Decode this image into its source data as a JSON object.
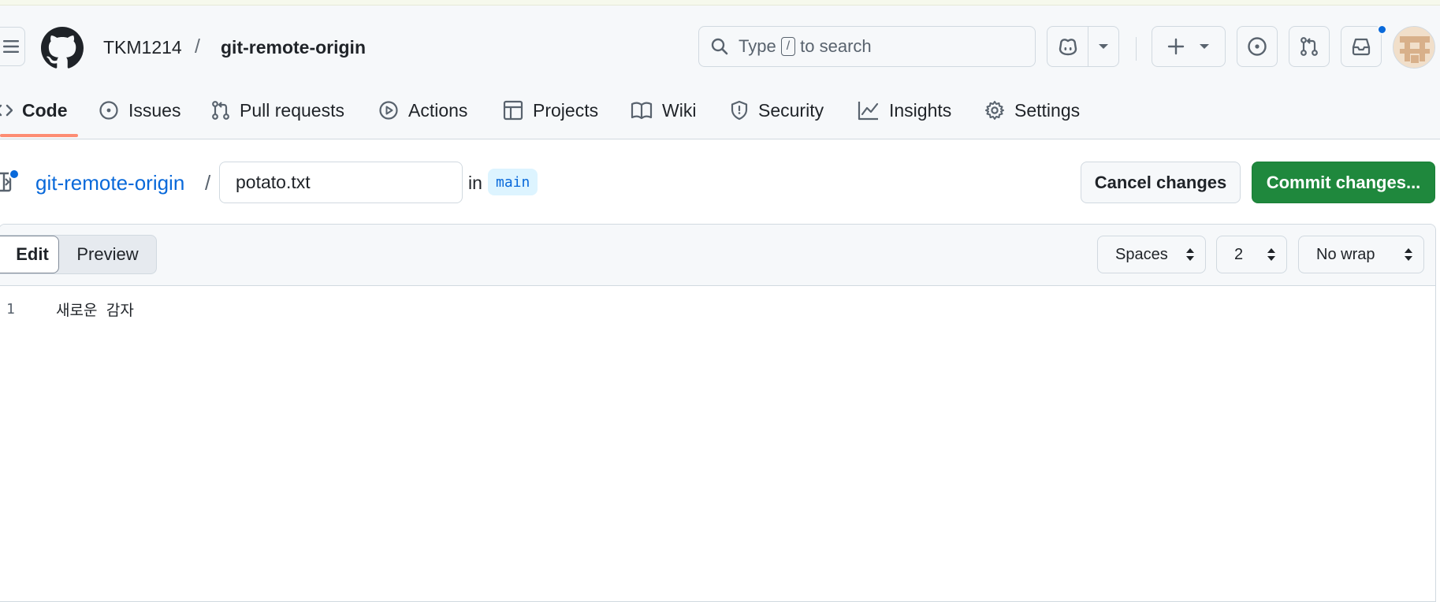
{
  "header": {
    "owner": "TKM1214",
    "separator": "/",
    "repo": "git-remote-origin",
    "search": {
      "prefix": "Type",
      "key": "/",
      "suffix": "to search"
    }
  },
  "tabs": [
    {
      "label": "Code",
      "icon": "code-icon"
    },
    {
      "label": "Issues",
      "icon": "issue-icon"
    },
    {
      "label": "Pull requests",
      "icon": "pull-request-icon"
    },
    {
      "label": "Actions",
      "icon": "play-icon"
    },
    {
      "label": "Projects",
      "icon": "table-icon"
    },
    {
      "label": "Wiki",
      "icon": "book-icon"
    },
    {
      "label": "Security",
      "icon": "shield-icon"
    },
    {
      "label": "Insights",
      "icon": "graph-icon"
    },
    {
      "label": "Settings",
      "icon": "gear-icon"
    }
  ],
  "file_bar": {
    "repo_link": "git-remote-origin",
    "separator": "/",
    "filename": "potato.txt",
    "in_label": "in",
    "branch": "main",
    "cancel_label": "Cancel changes",
    "commit_label": "Commit changes..."
  },
  "editor": {
    "edit_label": "Edit",
    "preview_label": "Preview",
    "indent_mode": "Spaces",
    "indent_size": "2",
    "wrap_mode": "No wrap",
    "lines": [
      {
        "number": "1",
        "text": "새로운 감자"
      }
    ]
  },
  "colors": {
    "accent_blue": "#0969da",
    "commit_green": "#1f883d",
    "tab_underline": "#fd8c73"
  }
}
